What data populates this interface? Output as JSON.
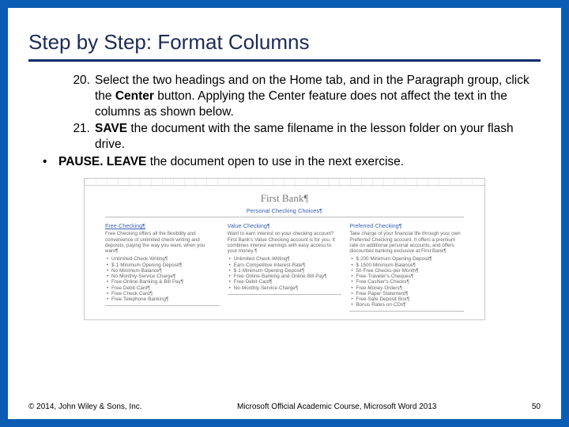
{
  "title": "Step by Step: Format Columns",
  "steps": [
    {
      "num": "20.",
      "parts": [
        {
          "t": "Select the two headings and on the Home tab, and in the Paragraph group, click the ",
          "b": false
        },
        {
          "t": "Center",
          "b": true
        },
        {
          "t": " button. Applying the Center feature does not affect the text in the columns as shown below.",
          "b": false
        }
      ]
    },
    {
      "num": "21.",
      "parts": [
        {
          "t": " ",
          "b": false
        },
        {
          "t": "SAVE",
          "b": true
        },
        {
          "t": " the document with the same filename in the lesson folder on your flash drive.",
          "b": false
        }
      ]
    }
  ],
  "bullet": [
    {
      "t": "PAUSE. LEAVE",
      "b": true
    },
    {
      "t": " the document open to use in the next exercise.",
      "b": false
    }
  ],
  "wshot": {
    "title": "First Bank¶",
    "subtitle": "Personal Checking Choices¶",
    "cols": [
      {
        "head": "Free·Checking¶",
        "underline": true,
        "paras": [
          "Free Checking offers all the flexibility and convenience of",
          "unlimited check writing and deposits, paying the",
          "way you want, when you want¶"
        ],
        "items": [
          "Unlimited·Check·Writing¶",
          "$·1·Minimum·Opening·Deposit¶",
          "No·Minimum·Balance¶",
          "No·Monthly·Service·Charge¶",
          "Free·Online·Banking·&·Bill·Pay¶",
          "Free·Debit·Card¶",
          "Free·Check·Card¶",
          "Free·Telephone·Banking¶"
        ]
      },
      {
        "head": "Value·Checking¶",
        "underline": false,
        "paras": [
          "Want to earn interest on your checking account? First",
          "Bank's Value Checking account is for you. It combines interest",
          "earnings with easy access to your money.¶"
        ],
        "items": [
          "Unlimited·Check·Writing¶",
          "Earn·Competitive·Interest·Rate¶",
          "$·1·Minimum·Opening·Deposit¶",
          "Free·Online·Banking·and·Online·Bill·Pay¶",
          "Free·Debit·Card¶",
          "No·Monthly·Service·Charge¶"
        ]
      },
      {
        "head": "Preferred·Checking¶",
        "underline": false,
        "paras": [
          "Take charge of your financial life through your own",
          "Preferred Checking account. It offers a premium rate on",
          "additional personal accounts, and offers discounted banking",
          "exclusive at First Bank¶"
        ],
        "items": [
          "$·200·Minimum·Opening·Deposit¶",
          "$·1500·Minimum·Balance¶",
          "50·Free·Checks·per·Month¶",
          "Free·Traveler's·Cheques¶",
          "Free·Cashier's·Checks¶",
          "Free·Money·Orders¶",
          "Free·Paper·Statement¶",
          "Free·Safe·Deposit·Box¶",
          "Bonus·Rates·on·CDs¶"
        ]
      }
    ]
  },
  "footer": {
    "left": "© 2014, John Wiley & Sons, Inc.",
    "center": "Microsoft Official Academic Course, Microsoft Word 2013",
    "right": "50"
  }
}
